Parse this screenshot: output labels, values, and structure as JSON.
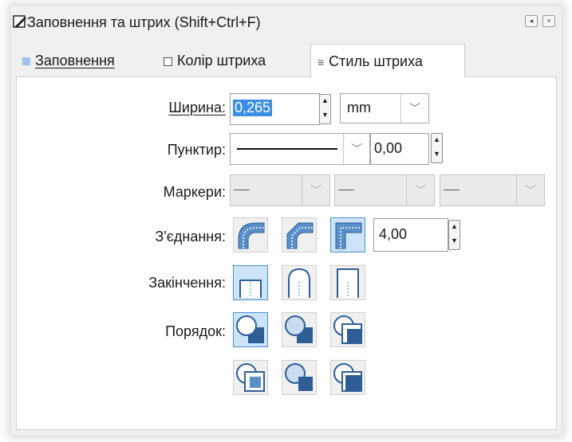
{
  "window": {
    "title": "Заповнення та штрих (Shift+Ctrl+F)"
  },
  "tabs": [
    {
      "label": "Заповнення",
      "active": false
    },
    {
      "label": "Колір штриха",
      "active": false
    },
    {
      "label": "Стиль штриха",
      "active": true
    }
  ],
  "stroke_style": {
    "width": {
      "label": "Ширина:",
      "value": "0,265",
      "unit": "mm"
    },
    "dash": {
      "label": "Пунктир:",
      "offset": "0,00"
    },
    "markers": {
      "label": "Маркери:"
    },
    "join": {
      "label": "З'єднання:",
      "miter_limit": "4,00",
      "options": [
        "round-join",
        "bevel-join",
        "miter-join"
      ],
      "selected": "miter-join"
    },
    "cap": {
      "label": "Закінчення:",
      "options": [
        "butt-cap",
        "round-cap",
        "square-cap"
      ],
      "selected": "butt-cap"
    },
    "order": {
      "label": "Порядок:",
      "selected": "order-1"
    }
  }
}
